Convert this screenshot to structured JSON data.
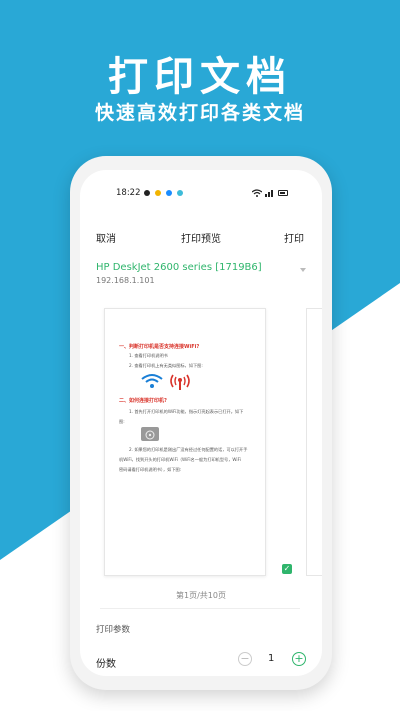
{
  "banner": {
    "title": "打印文档",
    "subtitle": "快速高效打印各类文档"
  },
  "colors": {
    "brand_blue": "#29a8d6",
    "accent_green": "#2fb56c",
    "warning_red": "#d9342b"
  },
  "status_bar": {
    "time": "18:22"
  },
  "nav": {
    "cancel": "取消",
    "title": "打印预览",
    "print": "打印"
  },
  "printer": {
    "name": "HP DeskJet 2600 series [1719B6]",
    "ip": "192.168.1.101",
    "dropdown_icon": "chevron-down-icon"
  },
  "document": {
    "heading1": "一、判断打印机是否支持连接WiFi?",
    "line1": "1. 查看打印机说明书",
    "line2": "2. 查看打印机上有无类似图标，如下图:",
    "heading2": "二、如何连接打印机?",
    "line3": "1. 首先打开打印机的WiFi功能，指示灯亮起表示已打开。如下",
    "line4": "图:",
    "line5": "2. 如果您的打印机是刚出厂没有经过任何配置的话，可以打开手",
    "line6": "机WiFi，找到开头的打印机WiFi（WiFi名一般为打印机型号，WiFi",
    "line7": "密码请看打印机说明书），如下图:"
  },
  "preview": {
    "page_indicator": "第1页/共10页"
  },
  "params": {
    "section_label": "打印参数",
    "copies_label": "份数",
    "copies_value": "1",
    "minus": "−",
    "plus": "+"
  }
}
